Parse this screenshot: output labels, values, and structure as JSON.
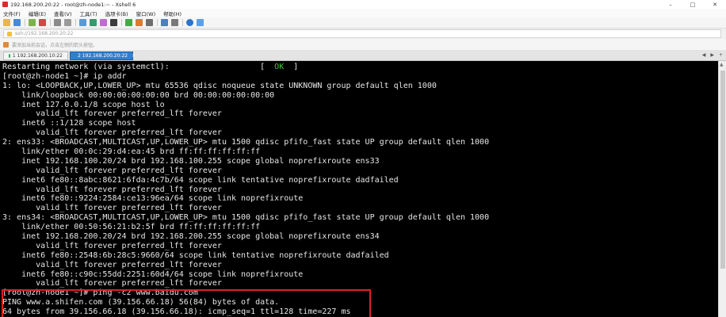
{
  "window": {
    "title": "192.168.200.20:22 - root@zh-node1:~ - Xshell 6",
    "controls": [
      "–",
      "□",
      "✕"
    ]
  },
  "menu": [
    "文件(F)",
    "编辑(E)",
    "查看(V)",
    "工具(T)",
    "选项卡(B)",
    "窗口(W)",
    "帮助(H)"
  ],
  "address": {
    "text": "ssh://192.168.200.20:22",
    "icon": "lock-icon"
  },
  "hint": {
    "text": "要添加当前会话，点击左侧的箭头按钮。"
  },
  "tabs": [
    {
      "label": "1 192.168.200.10:22",
      "active": false,
      "status_color": "#27a35a"
    },
    {
      "label": "2 192.168.200.20:22",
      "active": true,
      "status_color": "#f5c400"
    }
  ],
  "tab_nav": [
    "◀",
    "▶",
    "+"
  ],
  "terminal": {
    "lines": [
      {
        "pre": "Restarting network (via systemctl):                   [  ",
        "ok": "OK",
        "post": "  ]"
      },
      {
        "text": "[root@zh-node1 ~]# ip addr"
      },
      {
        "text": "1: lo: <LOOPBACK,UP,LOWER_UP> mtu 65536 qdisc noqueue state UNKNOWN group default qlen 1000"
      },
      {
        "text": "    link/loopback 00:00:00:00:00:00 brd 00:00:00:00:00:00"
      },
      {
        "text": "    inet 127.0.0.1/8 scope host lo"
      },
      {
        "text": "       valid_lft forever preferred_lft forever"
      },
      {
        "text": "    inet6 ::1/128 scope host"
      },
      {
        "text": "       valid_lft forever preferred_lft forever"
      },
      {
        "text": "2: ens33: <BROADCAST,MULTICAST,UP,LOWER_UP> mtu 1500 qdisc pfifo_fast state UP group default qlen 1000"
      },
      {
        "text": "    link/ether 00:0c:29:d4:ea:45 brd ff:ff:ff:ff:ff:ff"
      },
      {
        "text": "    inet 192.168.100.20/24 brd 192.168.100.255 scope global noprefixroute ens33"
      },
      {
        "text": "       valid_lft forever preferred_lft forever"
      },
      {
        "text": "    inet6 fe80::8abc:8621:6fda:4c7b/64 scope link tentative noprefixroute dadfailed"
      },
      {
        "text": "       valid_lft forever preferred_lft forever"
      },
      {
        "text": "    inet6 fe80::9224:2584:ce13:96ea/64 scope link noprefixroute"
      },
      {
        "text": "       valid_lft forever preferred_lft forever"
      },
      {
        "text": "3: ens34: <BROADCAST,MULTICAST,UP,LOWER_UP> mtu 1500 qdisc pfifo_fast state UP group default qlen 1000"
      },
      {
        "text": "    link/ether 00:50:56:21:b2:5f brd ff:ff:ff:ff:ff:ff"
      },
      {
        "text": "    inet 192.168.200.20/24 brd 192.168.200.255 scope global noprefixroute ens34"
      },
      {
        "text": "       valid_lft forever preferred_lft forever"
      },
      {
        "text": "    inet6 fe80::2548:6b:28c5:9660/64 scope link tentative noprefixroute dadfailed"
      },
      {
        "text": "       valid_lft forever preferred_lft forever"
      },
      {
        "text": "    inet6 fe80::c90c:55dd:2251:60d4/64 scope link noprefixroute"
      },
      {
        "text": "       valid_lft forever preferred_lft forever"
      },
      {
        "text": "[root@zh-node1 ~]# ping -c2 www.baidu.com"
      },
      {
        "text": "PING www.a.shifen.com (39.156.66.18) 56(84) bytes of data."
      },
      {
        "text": "64 bytes from 39.156.66.18 (39.156.66.18): icmp_seq=1 ttl=128 time=227 ms"
      }
    ]
  },
  "colors": {
    "terminal_bg": "#000000",
    "terminal_fg": "#e6e6e6",
    "ok": "#3ccc3c",
    "highlight": "#e02020",
    "active_tab": "#2f7fd0"
  }
}
